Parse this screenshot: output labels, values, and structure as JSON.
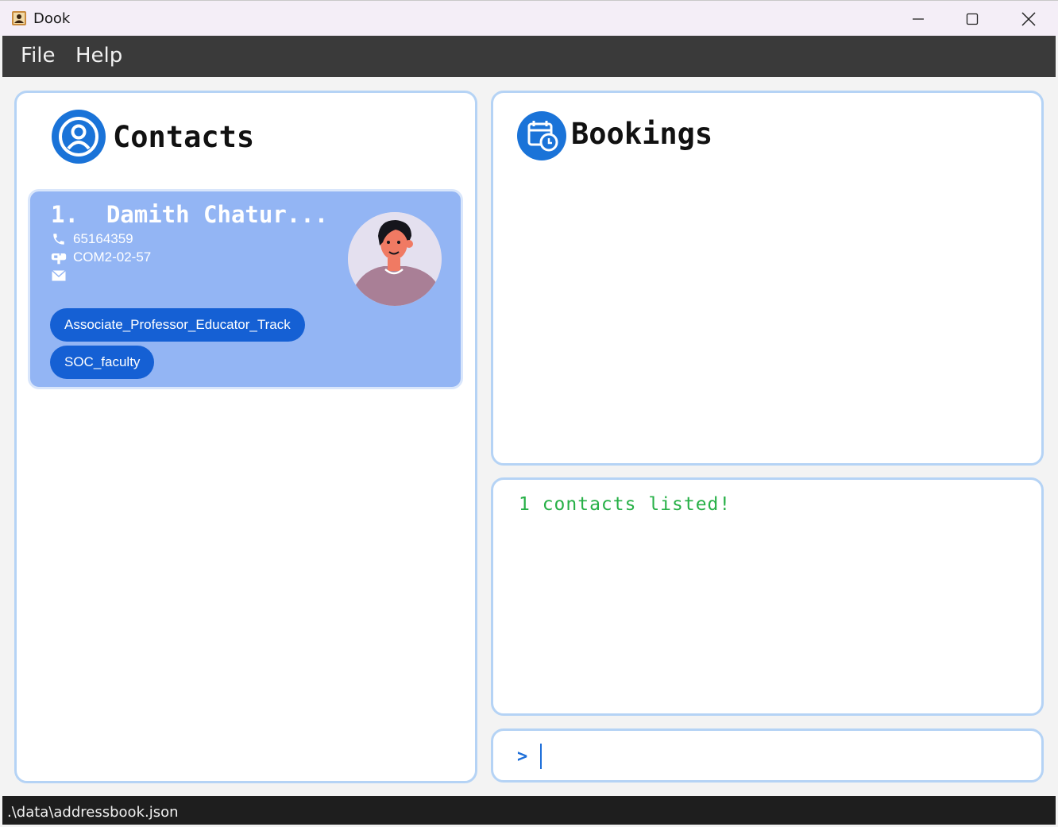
{
  "window": {
    "title": "Dook",
    "icons": {
      "app": "address-book-icon",
      "minimize": "minimize-icon",
      "maximize": "maximize-icon",
      "close": "close-icon"
    }
  },
  "menu": {
    "items": [
      "File",
      "Help"
    ]
  },
  "contacts_panel": {
    "title": "Contacts",
    "icon": "user-circle-icon",
    "cards": [
      {
        "name": "1.  Damith Chatur...",
        "phone": "65164359",
        "address": "COM2-02-57",
        "email": "",
        "tags": [
          "Associate_Professor_Educator_Track",
          "SOC_faculty"
        ],
        "avatar": "avatar-illustration"
      }
    ]
  },
  "bookings_panel": {
    "title": "Bookings",
    "icon": "calendar-clock-icon"
  },
  "result_panel": {
    "message": "1 contacts listed!"
  },
  "command_box": {
    "prompt": ">",
    "value": ""
  },
  "status_bar": {
    "path": ".\\data\\addressbook.json"
  },
  "colors": {
    "accent": "#1e6fd9",
    "card_bg": "#93b5f4",
    "tag_bg": "#1560d4",
    "panel_border": "#b5d3f5",
    "success_text": "#27b047",
    "menubar_bg": "#3a3a3a"
  }
}
